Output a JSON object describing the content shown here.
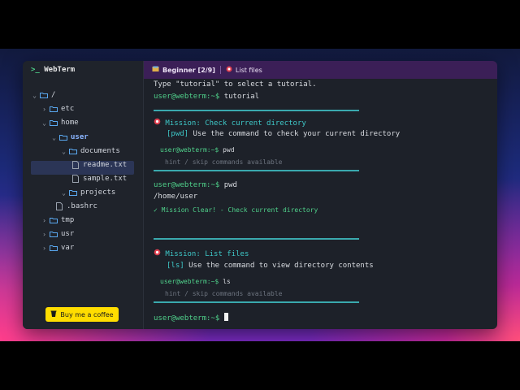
{
  "app": {
    "brand_prompt": ">_",
    "brand_name": "WebTerm"
  },
  "colors": {
    "accent_green": "#4fd08a",
    "accent_cyan": "#3ec8c8",
    "topbar_bg": "#3b1f57",
    "coffee_yellow": "#ffdd00"
  },
  "tree": {
    "root": "/",
    "etc": "etc",
    "home": "home",
    "user": "user",
    "documents": "documents",
    "readme": "readme.txt",
    "sample": "sample.txt",
    "projects": "projects",
    "bashrc": ".bashrc",
    "tmp": "tmp",
    "usr": "usr",
    "var": "var"
  },
  "coffee_label": "Buy me a coffee",
  "topbar": {
    "level": "Beginner [2/9]",
    "mission": "List files"
  },
  "terminal": {
    "intro": "Type \"tutorial\" to select a tutorial.",
    "prompt": "user@webterm:~$",
    "cmd_tutorial": "tutorial",
    "m1_title": "Mission: Check current directory",
    "m1_cmd": "[pwd]",
    "m1_desc": "Use the command to check your current directory",
    "m1_example": "pwd",
    "hint": "hint / skip commands available",
    "cmd_pwd": "pwd",
    "pwd_output": "/home/user",
    "m1_clear": "✓ Mission Clear! - Check current directory",
    "m2_title": "Mission: List files",
    "m2_cmd": "[ls]",
    "m2_desc": "Use the command to view directory contents",
    "m2_example": "ls"
  }
}
